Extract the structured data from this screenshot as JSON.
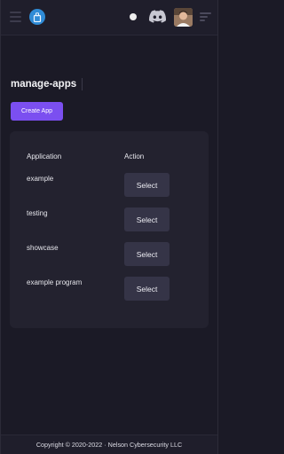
{
  "header": {
    "hamburger_icon": "hamburger-icon",
    "logo_icon": "app-logo-icon",
    "status_dot_color": "#eeeeee",
    "discord_icon": "discord-icon",
    "avatar_icon": "user-avatar",
    "menu_icon": "menu-lines-icon",
    "accent_color": "#7b4ff0"
  },
  "page": {
    "title": "manage-apps",
    "create_button_label": "Create App"
  },
  "table": {
    "columns": [
      "Application",
      "Action"
    ],
    "rows": [
      {
        "application": "example",
        "action": "Select"
      },
      {
        "application": "testing",
        "action": "Select"
      },
      {
        "application": "showcase",
        "action": "Select"
      },
      {
        "application": "example program",
        "action": "Select"
      }
    ]
  },
  "footer": {
    "copyright": "Copyright © 2020-2022 · Nelson Cybersecurity LLC"
  }
}
